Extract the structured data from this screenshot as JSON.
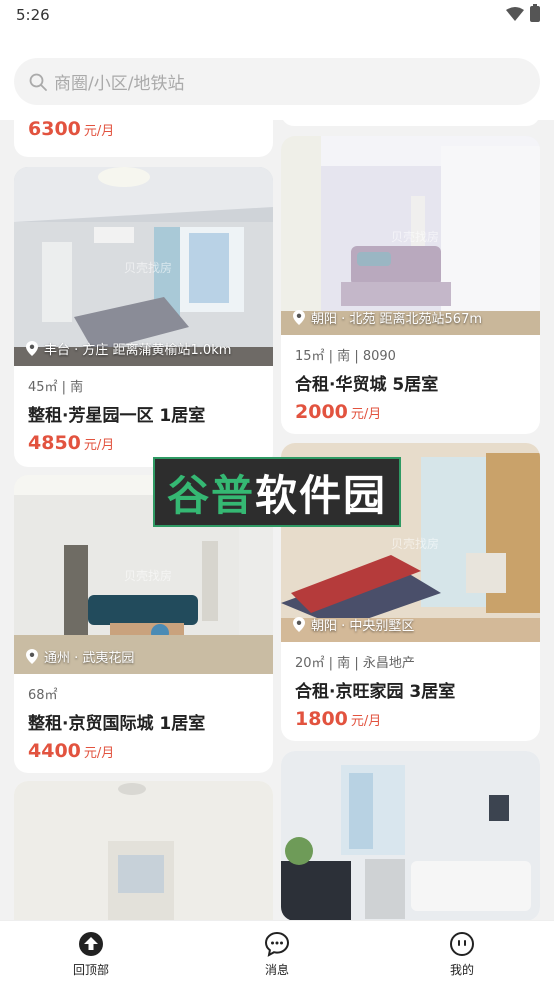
{
  "status": {
    "time": "5:26"
  },
  "search": {
    "placeholder": "商圈/小区/地铁站"
  },
  "cards": [
    {
      "price": "6300",
      "unit": "元/月"
    },
    {
      "location": "丰台 · 方庄 距离蒲黄榆站1.0km",
      "meta": "45㎡ | 南",
      "title": "整租·芳星园一区 1居室",
      "price": "4850",
      "unit": "元/月"
    },
    {
      "location": "通州 · 武夷花园",
      "meta": "68㎡",
      "title": "整租·京贸国际城 1居室",
      "price": "4400",
      "unit": "元/月"
    },
    {
      "location": "朝阳 · 北苑 距离北苑站567m",
      "meta": "15㎡ | 南 | 8090",
      "title": "合租·华贸城 5居室",
      "price": "2000",
      "unit": "元/月"
    },
    {
      "location": "朝阳 · 中央别墅区",
      "meta": "20㎡ | 南 | 永昌地产",
      "title": "合租·京旺家园 3居室",
      "price": "1800",
      "unit": "元/月"
    }
  ],
  "photo_watermark": "贝壳找房",
  "overlay_banner": {
    "part1": "谷普",
    "part2": "软件园"
  },
  "tabs": [
    {
      "label": "回顶部",
      "icon": "arrow-up-circle-icon"
    },
    {
      "label": "消息",
      "icon": "chat-bubble-icon"
    },
    {
      "label": "我的",
      "icon": "face-icon"
    }
  ],
  "colors": {
    "price": "#e2533f",
    "banner_green": "#35b873"
  }
}
